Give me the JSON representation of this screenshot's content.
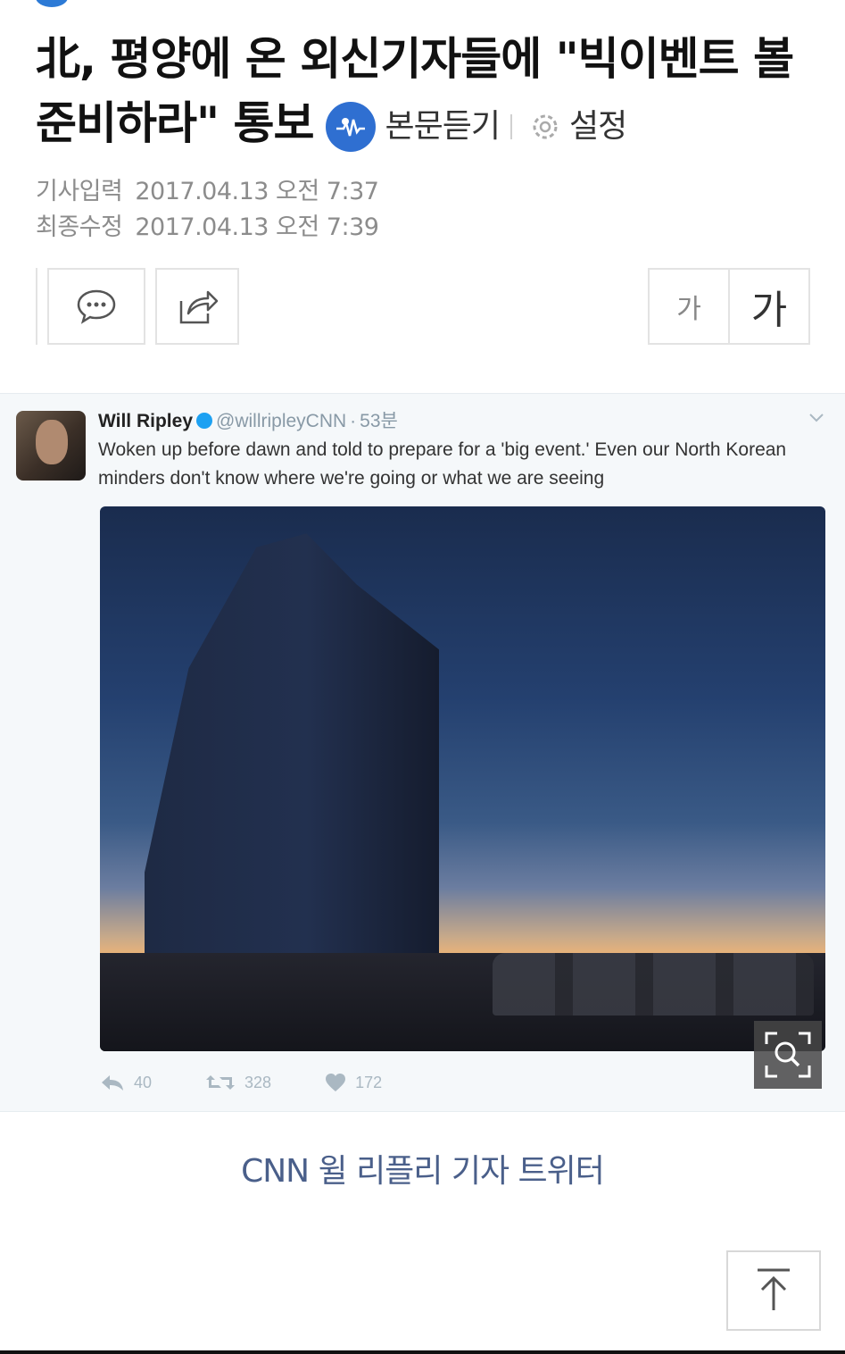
{
  "article": {
    "title": "北, 평양에 온 외신기자들에 \"빅이벤트 볼 준비하라\" 통보",
    "listen_label": "본문듣기",
    "settings_label": "설정",
    "published_label": "기사입력",
    "published_value": "2017.04.13 오전 7:37",
    "modified_label": "최종수정",
    "modified_value": "2017.04.13 오전 7:39"
  },
  "toolbar": {
    "comment_icon": "speech-bubble-icon",
    "share_icon": "share-icon",
    "font_small": "가",
    "font_large": "가"
  },
  "tweet": {
    "name": "Will Ripley",
    "handle": "@willripleyCNN",
    "separator": "·",
    "time": "53분",
    "text": "Woken up before dawn and told to prepare for a 'big event.' Even our North Korean minders don't know where we're going or what we are seeing",
    "reply_count": "40",
    "retweet_count": "328",
    "like_count": "172"
  },
  "caption": "CNN 윌 리플리 기자 트위터",
  "colors": {
    "accent": "#2f6fd1",
    "caption": "#4a5f8a",
    "meta": "#8c8c8c"
  }
}
